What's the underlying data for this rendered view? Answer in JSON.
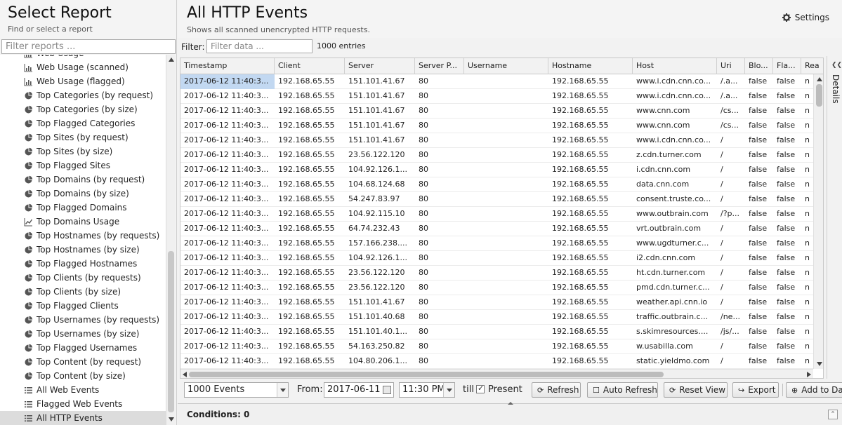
{
  "sidebar": {
    "title": "Select Report",
    "subtitle": "Find or select a report",
    "filter_placeholder": "Filter reports ...",
    "items": [
      {
        "label": "Web Usage",
        "icon": "bar-chart-icon"
      },
      {
        "label": "Web Usage (scanned)",
        "icon": "bar-chart-icon"
      },
      {
        "label": "Web Usage (flagged)",
        "icon": "bar-chart-icon"
      },
      {
        "label": "Top Categories (by request)",
        "icon": "pie-chart-icon"
      },
      {
        "label": "Top Categories (by size)",
        "icon": "pie-chart-icon"
      },
      {
        "label": "Top Flagged Categories",
        "icon": "pie-chart-icon"
      },
      {
        "label": "Top Sites (by request)",
        "icon": "pie-chart-icon"
      },
      {
        "label": "Top Sites (by size)",
        "icon": "pie-chart-icon"
      },
      {
        "label": "Top Flagged Sites",
        "icon": "pie-chart-icon"
      },
      {
        "label": "Top Domains (by request)",
        "icon": "pie-chart-icon"
      },
      {
        "label": "Top Domains (by size)",
        "icon": "pie-chart-icon"
      },
      {
        "label": "Top Flagged Domains",
        "icon": "pie-chart-icon"
      },
      {
        "label": "Top Domains Usage",
        "icon": "line-chart-icon"
      },
      {
        "label": "Top Hostnames (by requests)",
        "icon": "pie-chart-icon"
      },
      {
        "label": "Top Hostnames (by size)",
        "icon": "pie-chart-icon"
      },
      {
        "label": "Top Flagged Hostnames",
        "icon": "pie-chart-icon"
      },
      {
        "label": "Top Clients (by requests)",
        "icon": "pie-chart-icon"
      },
      {
        "label": "Top Clients (by size)",
        "icon": "pie-chart-icon"
      },
      {
        "label": "Top Flagged Clients",
        "icon": "pie-chart-icon"
      },
      {
        "label": "Top Usernames (by requests)",
        "icon": "pie-chart-icon"
      },
      {
        "label": "Top Usernames (by size)",
        "icon": "pie-chart-icon"
      },
      {
        "label": "Top Flagged Usernames",
        "icon": "pie-chart-icon"
      },
      {
        "label": "Top Content (by request)",
        "icon": "pie-chart-icon"
      },
      {
        "label": "Top Content (by size)",
        "icon": "pie-chart-icon"
      },
      {
        "label": "All Web Events",
        "icon": "list-icon"
      },
      {
        "label": "Flagged Web Events",
        "icon": "list-icon"
      },
      {
        "label": "All HTTP Events",
        "icon": "list-icon",
        "selected": true
      }
    ]
  },
  "main": {
    "title": "All HTTP Events",
    "subtitle": "Shows all scanned unencrypted HTTP requests.",
    "settings_label": "Settings",
    "filter_label": "Filter:",
    "filter_placeholder": "Filter data ...",
    "entries": "1000 entries",
    "details_label": "Details"
  },
  "table": {
    "columns": [
      "Timestamp",
      "Client",
      "Server",
      "Server P...",
      "Username",
      "Hostname",
      "Host",
      "Uri",
      "Blo...",
      "Fla...",
      "Rea"
    ],
    "rows": [
      [
        "2017-06-12 11:40:3...",
        "192.168.65.55",
        "151.101.41.67",
        "80",
        "",
        "192.168.65.55",
        "www.i.cdn.cnn.co...",
        "/.a...",
        "false",
        "false",
        "n"
      ],
      [
        "2017-06-12 11:40:3...",
        "192.168.65.55",
        "151.101.41.67",
        "80",
        "",
        "192.168.65.55",
        "www.i.cdn.cnn.co...",
        "/.a...",
        "false",
        "false",
        "n"
      ],
      [
        "2017-06-12 11:40:3...",
        "192.168.65.55",
        "151.101.41.67",
        "80",
        "",
        "192.168.65.55",
        "www.cnn.com",
        "/cs...",
        "false",
        "false",
        "n"
      ],
      [
        "2017-06-12 11:40:3...",
        "192.168.65.55",
        "151.101.41.67",
        "80",
        "",
        "192.168.65.55",
        "www.cnn.com",
        "/cs...",
        "false",
        "false",
        "n"
      ],
      [
        "2017-06-12 11:40:3...",
        "192.168.65.55",
        "151.101.41.67",
        "80",
        "",
        "192.168.65.55",
        "www.i.cdn.cnn.co...",
        "/",
        "false",
        "false",
        "n"
      ],
      [
        "2017-06-12 11:40:3...",
        "192.168.65.55",
        "23.56.122.120",
        "80",
        "",
        "192.168.65.55",
        "z.cdn.turner.com",
        "/",
        "false",
        "false",
        "n"
      ],
      [
        "2017-06-12 11:40:3...",
        "192.168.65.55",
        "104.92.126.1...",
        "80",
        "",
        "192.168.65.55",
        "i.cdn.cnn.com",
        "/",
        "false",
        "false",
        "n"
      ],
      [
        "2017-06-12 11:40:3...",
        "192.168.65.55",
        "104.68.124.68",
        "80",
        "",
        "192.168.65.55",
        "data.cnn.com",
        "/",
        "false",
        "false",
        "n"
      ],
      [
        "2017-06-12 11:40:3...",
        "192.168.65.55",
        "54.247.83.97",
        "80",
        "",
        "192.168.65.55",
        "consent.truste.co...",
        "/",
        "false",
        "false",
        "n"
      ],
      [
        "2017-06-12 11:40:3...",
        "192.168.65.55",
        "104.92.115.10",
        "80",
        "",
        "192.168.65.55",
        "www.outbrain.com",
        "/?p...",
        "false",
        "false",
        "n"
      ],
      [
        "2017-06-12 11:40:3...",
        "192.168.65.55",
        "64.74.232.43",
        "80",
        "",
        "192.168.65.55",
        "vrt.outbrain.com",
        "/",
        "false",
        "false",
        "n"
      ],
      [
        "2017-06-12 11:40:3...",
        "192.168.65.55",
        "157.166.238....",
        "80",
        "",
        "192.168.65.55",
        "www.ugdturner.c...",
        "/",
        "false",
        "false",
        "n"
      ],
      [
        "2017-06-12 11:40:3...",
        "192.168.65.55",
        "104.92.126.1...",
        "80",
        "",
        "192.168.65.55",
        "i2.cdn.cnn.com",
        "/",
        "false",
        "false",
        "n"
      ],
      [
        "2017-06-12 11:40:3...",
        "192.168.65.55",
        "23.56.122.120",
        "80",
        "",
        "192.168.65.55",
        "ht.cdn.turner.com",
        "/",
        "false",
        "false",
        "n"
      ],
      [
        "2017-06-12 11:40:3...",
        "192.168.65.55",
        "23.56.122.120",
        "80",
        "",
        "192.168.65.55",
        "pmd.cdn.turner.c...",
        "/",
        "false",
        "false",
        "n"
      ],
      [
        "2017-06-12 11:40:3...",
        "192.168.65.55",
        "151.101.41.67",
        "80",
        "",
        "192.168.65.55",
        "weather.api.cnn.io",
        "/",
        "false",
        "false",
        "n"
      ],
      [
        "2017-06-12 11:40:3...",
        "192.168.65.55",
        "151.101.40.68",
        "80",
        "",
        "192.168.65.55",
        "traffic.outbrain.c...",
        "/ne...",
        "false",
        "false",
        "n"
      ],
      [
        "2017-06-12 11:40:3...",
        "192.168.65.55",
        "151.101.40.1...",
        "80",
        "",
        "192.168.65.55",
        "s.skimresources....",
        "/js/...",
        "false",
        "false",
        "n"
      ],
      [
        "2017-06-12 11:40:3...",
        "192.168.65.55",
        "54.163.250.82",
        "80",
        "",
        "192.168.65.55",
        "w.usabilla.com",
        "/",
        "false",
        "false",
        "n"
      ],
      [
        "2017-06-12 11:40:3...",
        "192.168.65.55",
        "104.80.206.1...",
        "80",
        "",
        "192.168.65.55",
        "static.yieldmo.com",
        "/",
        "false",
        "false",
        "n"
      ]
    ]
  },
  "toolbar": {
    "events_select": "1000 Events",
    "from_label": "From:",
    "from_date": "2017-06-11",
    "from_time": "11:30 PM",
    "till_label": "till",
    "present_label": "Present",
    "present_checked": true,
    "refresh": "Refresh",
    "auto_refresh": "Auto Refresh",
    "reset_view": "Reset View",
    "export": "Export",
    "add_to_dashboard": "Add to Dashboard"
  },
  "conditions": {
    "label": "Conditions: 0"
  }
}
